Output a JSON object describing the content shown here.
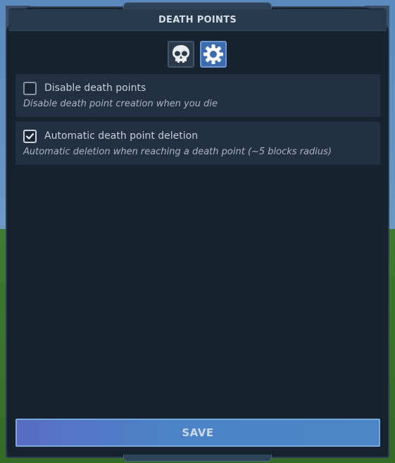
{
  "window": {
    "title": "DEATH POINTS"
  },
  "tabs": [
    {
      "icon": "skull-icon",
      "selected": false
    },
    {
      "icon": "gear-icon",
      "selected": true
    }
  ],
  "options": [
    {
      "label": "Disable death points",
      "description": "Disable death point creation when you die",
      "checked": false
    },
    {
      "label": "Automatic death point deletion",
      "description": "Automatic deletion when reaching a death point (~5 blocks radius)",
      "checked": true
    }
  ],
  "footer": {
    "save_label": "SAVE"
  },
  "colors": {
    "panel_bg": "#17222f",
    "title_bar": "#283a4d",
    "option_bg": "#213042",
    "accent": "#3c6cb0",
    "save_button": "#4c82c8"
  }
}
